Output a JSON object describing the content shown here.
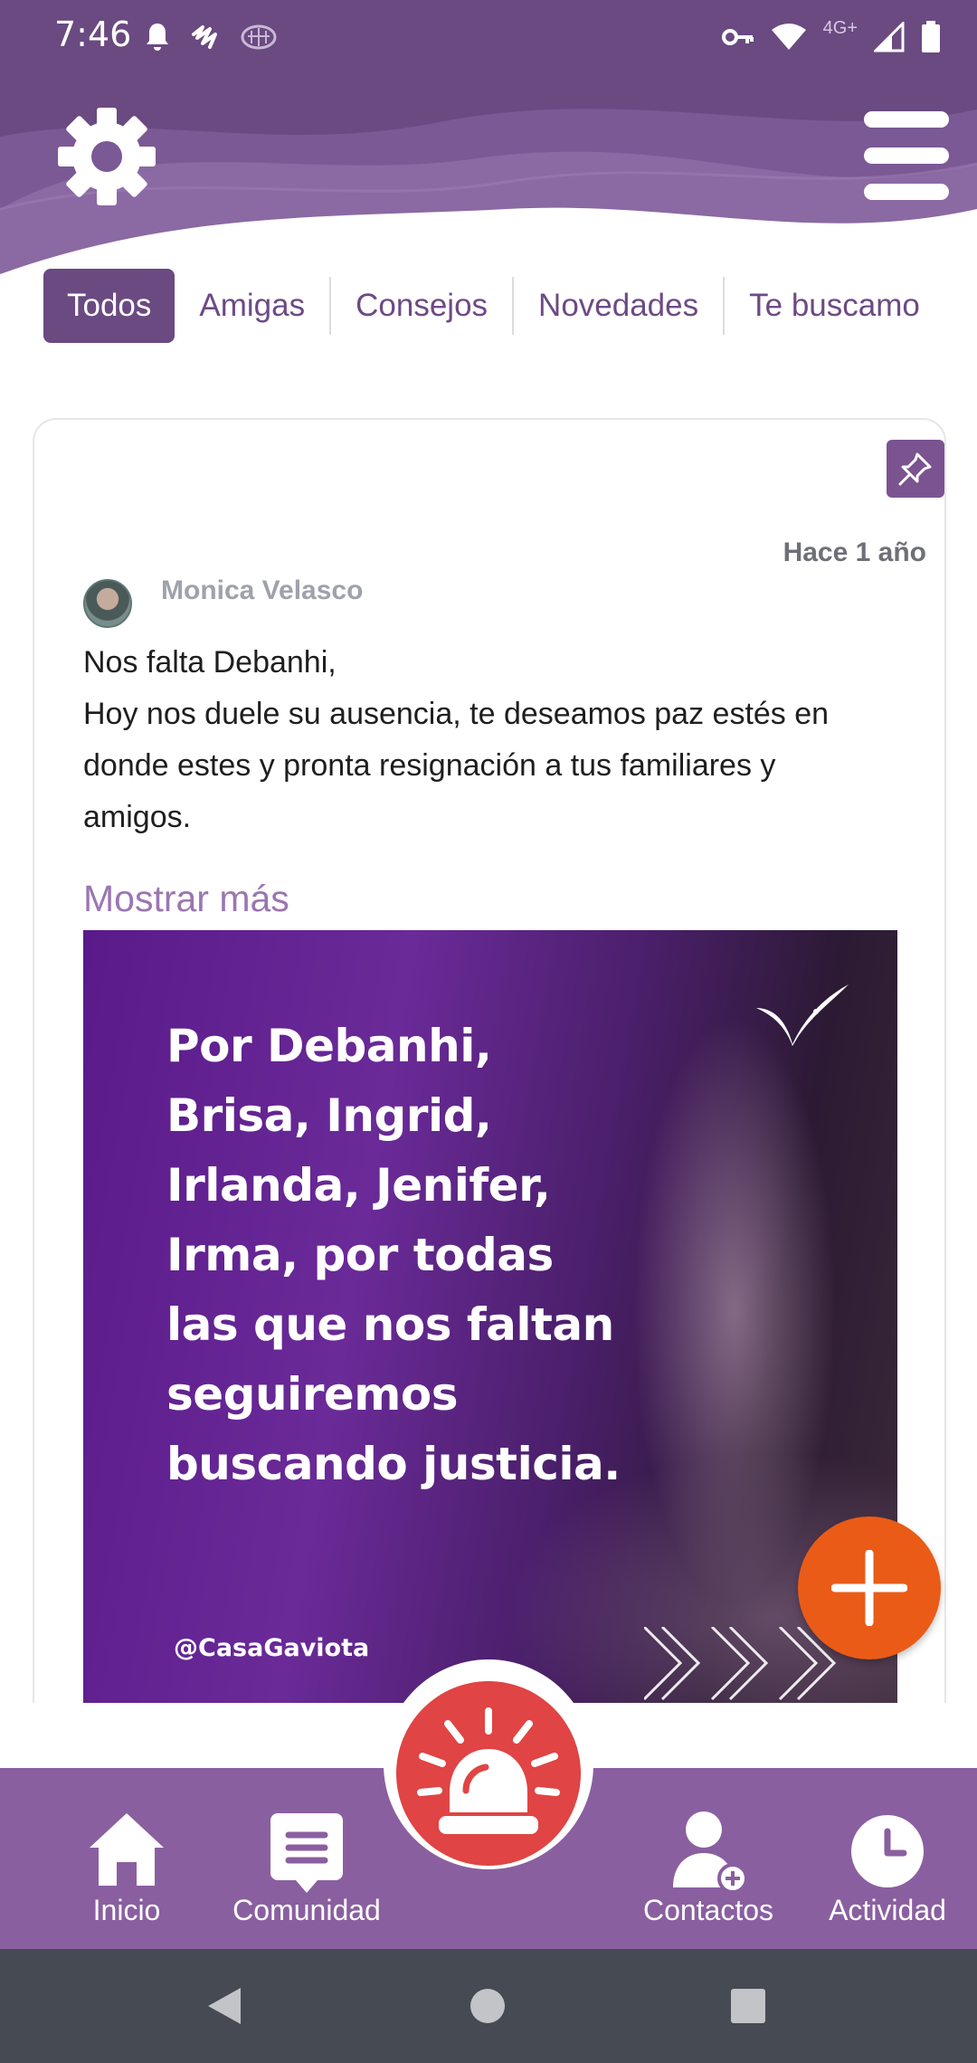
{
  "status_bar": {
    "time": "7:46",
    "network": "4G+",
    "icons": [
      "bell-icon",
      "squiggle-icon",
      "brain-icon",
      "key-icon",
      "wifi-icon",
      "signal-icon",
      "battery-icon"
    ]
  },
  "header": {
    "settings_icon": "gear-icon",
    "menu_icon": "hamburger-menu-icon"
  },
  "tabs": [
    {
      "label": "Todos",
      "active": true
    },
    {
      "label": "Amigas",
      "active": false
    },
    {
      "label": "Consejos",
      "active": false
    },
    {
      "label": "Novedades",
      "active": false
    },
    {
      "label": "Te buscamo",
      "active": false
    }
  ],
  "post": {
    "time_ago": "Hace 1 año",
    "author": "Monica Velasco",
    "text_lines": [
      "Nos falta Debanhi,",
      "Hoy nos duele su ausencia, te deseamos paz estés en",
      "donde estes y pronta resignación a tus familiares y",
      "amigos."
    ],
    "show_more": "Mostrar más",
    "image": {
      "lines": [
        "Por Debanhi,",
        "Brisa, Ingrid,",
        "Irlanda, Jenifer,",
        "Irma, por todas",
        "las que nos faltan",
        "seguiremos",
        "buscando justicia."
      ],
      "handle": "@CasaGaviota"
    }
  },
  "bottom_nav": {
    "items": [
      {
        "label": "Inicio",
        "icon": "home-icon"
      },
      {
        "label": "Comunidad",
        "icon": "community-icon"
      },
      {
        "label": "Contactos",
        "icon": "contacts-icon"
      },
      {
        "label": "Actividad",
        "icon": "clock-icon"
      }
    ],
    "alarm_icon": "alarm-siren-icon"
  },
  "colors": {
    "primary": "#6a4a81",
    "nav_bg": "#8a5fa0",
    "fab": "#ea5b17",
    "alarm": "#e04444"
  }
}
